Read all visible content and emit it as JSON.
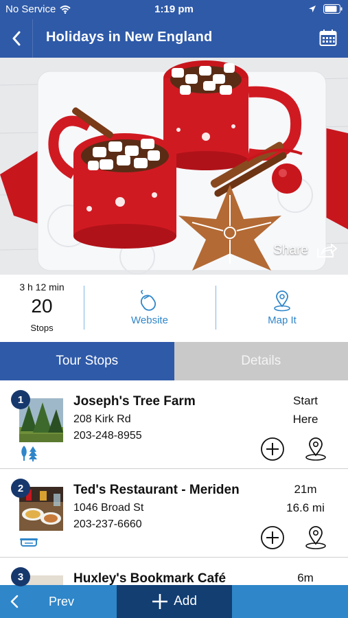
{
  "status_bar": {
    "carrier": "No Service",
    "time": "1:19 pm"
  },
  "nav": {
    "title": "Holidays in New England"
  },
  "hero": {
    "share_label": "Share"
  },
  "tour_info": {
    "duration": "3 h 12 min",
    "stop_count": "20",
    "stops_label": "Stops",
    "website_label": "Website",
    "mapit_label": "Map It"
  },
  "tabs": [
    {
      "label": "Tour Stops",
      "active": true
    },
    {
      "label": "Details",
      "active": false
    }
  ],
  "stops": [
    {
      "number": "1",
      "name": "Joseph's Tree Farm",
      "address": "208 Kirk Rd",
      "phone": "203-248-8955",
      "meta1": "Start",
      "meta2": "Here",
      "category_icon": "trees-icon"
    },
    {
      "number": "2",
      "name": "Ted's Restaurant - Meriden",
      "address": "1046 Broad St",
      "phone": "203-237-6660",
      "meta1": "21m",
      "meta2": "16.6 mi",
      "category_icon": "dish-icon"
    },
    {
      "number": "3",
      "name": "Huxley's Bookmark Café",
      "address": "",
      "phone": "",
      "meta1": "6m",
      "meta2": "",
      "category_icon": ""
    }
  ],
  "bottom_bar": {
    "prev_label": "Prev",
    "add_label": "Add"
  },
  "colors": {
    "primary": "#2f5aa8",
    "accent": "#2f86c9",
    "dark": "#17386d",
    "inactive_tab": "#c9c9c9"
  }
}
